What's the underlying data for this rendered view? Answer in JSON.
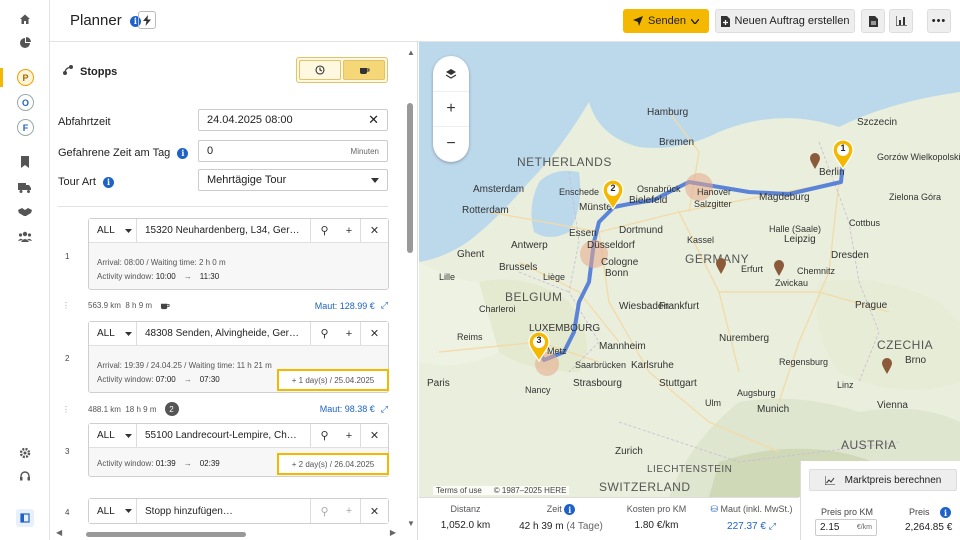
{
  "app": {
    "title": "Planner"
  },
  "header": {
    "send_label": "Senden",
    "new_order_label": "Neuen Auftrag erstellen"
  },
  "rail": {
    "letters": [
      "P",
      "O",
      "F"
    ]
  },
  "panel": {
    "section_title": "Stopps",
    "departure": {
      "label": "Abfahrtzeit",
      "value": "24.04.2025 08:00"
    },
    "driven_time": {
      "label": "Gefahrene Zeit am Tag",
      "value": "0",
      "unit": "Minuten"
    },
    "tour_type": {
      "label": "Tour Art",
      "value": "Mehrtägige Tour"
    },
    "stops": [
      {
        "num": "1",
        "filter": "ALL",
        "address": "15320 Neuhardenberg, L34, Ger…",
        "arrival": "Arrival: 08:00 / Waiting time: 2 h 0 m",
        "window_label": "Activity window:",
        "window_from": "10:00",
        "window_to": "11:30"
      },
      {
        "num": "2",
        "filter": "ALL",
        "address": "48308 Senden, Alvingheide, Ger…",
        "arrival": "Arrival: 19:39 / 24.04.25 / Waiting time: 11 h 21 m",
        "window_label": "Activity window:",
        "window_from": "07:00",
        "window_to": "07:30",
        "day_badge": "+ 1 day(s) / 25.04.2025"
      },
      {
        "num": "3",
        "filter": "ALL",
        "address": "55100 Landrecourt-Lempire, Ch…",
        "window_label": "Activity window:",
        "window_from": "01:39",
        "window_to": "02:39",
        "day_badge": "+ 2 day(s) / 26.04.2025"
      },
      {
        "num": "4",
        "filter": "ALL",
        "address": "Stopp hinzufügen…"
      }
    ],
    "segments": [
      {
        "dist": "563.9 km",
        "time": "8 h 9 m",
        "maut": "Maut: 128.99 €"
      },
      {
        "dist": "488.1 km",
        "time": "18 h 9 m",
        "badge": "2",
        "maut": "Maut: 98.38 €"
      }
    ]
  },
  "map": {
    "attribution": "Terms of use",
    "copyright": "© 1987–2025 HERE",
    "labels": {
      "hamburg": "Hamburg",
      "szczecin": "Szczecin",
      "netherlands": "NETHERLANDS",
      "bremen": "Bremen",
      "berlin": "Berlin",
      "amsterdam": "Amsterdam",
      "enschede": "Enschede",
      "osnabrueck": "Osnabrück",
      "hanover": "Hanover",
      "magdeburg": "Magdeburg",
      "muenster": "Münster",
      "bielefeld": "Bielefeld",
      "salzgitter": "Salzgitter",
      "rotterdam": "Rotterdam",
      "essen": "Essen",
      "dortmund": "Dortmund",
      "antwerp": "Antwerp",
      "duesseldorf": "Düsseldorf",
      "halle": "Halle (Saale)",
      "leipzig": "Leipzig",
      "cologne": "Cologne",
      "germany": "GERMANY",
      "dresden": "Dresden",
      "ghent": "Ghent",
      "brussels": "Brussels",
      "bonn": "Bonn",
      "belgium": "BELGIUM",
      "frankfurt": "Frankfurt",
      "wiesbaden": "Wiesbaden",
      "prague": "Prague",
      "luxembourg": "LUXEMBOURG",
      "nuremberg": "Nuremberg",
      "mannheim": "Mannheim",
      "czechia": "CZECHIA",
      "brno": "Brno",
      "saarbruecken": "Saarbrücken",
      "karlsruhe": "Karlsruhe",
      "paris": "Paris",
      "strasbourg": "Strasbourg",
      "stuttgart": "Stuttgart",
      "munich": "Munich",
      "vienna": "Vienna",
      "austria": "AUSTRIA",
      "liechtenstein": "LIECHTENSTEIN",
      "switzerland": "SWITZERLAND",
      "zurich": "Zurich",
      "ulm": "Ulm",
      "augsburg": "Augsburg",
      "regensburg": "Regensburg",
      "erfurt": "Erfurt",
      "kassel": "Kassel",
      "linz": "Linz",
      "reims": "Reims",
      "metz": "Metz",
      "lille": "Lille",
      "liege": "Liège",
      "charleroi": "Charleroi",
      "nancy": "Nancy",
      "chemnitz": "Chemnitz",
      "cottbus": "Cottbus",
      "gorzow": "Gorzów Wielkopolski",
      "zwickau": "Zwickau",
      "zielona": "Zielona Góra"
    },
    "pins": [
      {
        "label": "1"
      },
      {
        "label": "2"
      },
      {
        "label": "3"
      }
    ]
  },
  "summary": {
    "distance": {
      "label": "Distanz",
      "value": "1,052.0 km"
    },
    "time": {
      "label": "Zeit",
      "value": "42 h 39 m",
      "extra": "(4 Tage)"
    },
    "cost_km": {
      "label": "Kosten pro KM",
      "value": "1.80 €/km"
    },
    "maut": {
      "label": "Maut (inkl. MwSt.)",
      "value": "227.37 €"
    }
  },
  "pricing": {
    "market_label": "Marktpreis berechnen",
    "per_km_label": "Preis pro KM",
    "per_km_value": "2.15",
    "per_km_unit": "€/km",
    "price_label": "Preis",
    "price_value": "2,264.85 €"
  }
}
